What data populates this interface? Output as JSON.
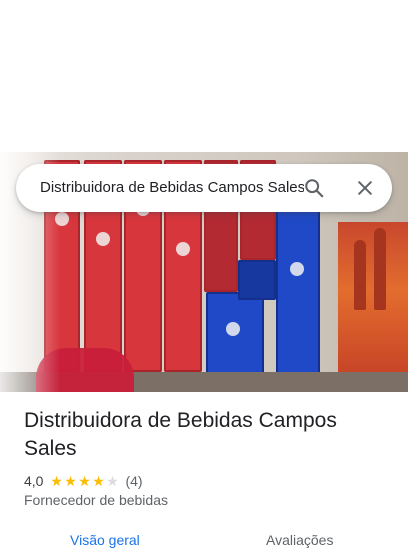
{
  "search": {
    "query": "Distribuidora de Bebidas Campos Sales",
    "search_icon": "search-icon",
    "close_icon": "close-icon"
  },
  "place": {
    "title": "Distribuidora de Bebidas Campos Sales",
    "rating": "4,0",
    "rating_stars_filled": 4,
    "rating_stars_total": 5,
    "review_count": "(4)",
    "category": "Fornecedor de bebidas"
  },
  "tabs": [
    {
      "label": "Visão geral",
      "active": true
    },
    {
      "label": "Avaliações",
      "active": false
    }
  ],
  "colors": {
    "accent": "#1a73e8",
    "star": "#fbbc04",
    "star_empty": "#dadce0",
    "text": "#202124",
    "muted": "#5f6368"
  }
}
